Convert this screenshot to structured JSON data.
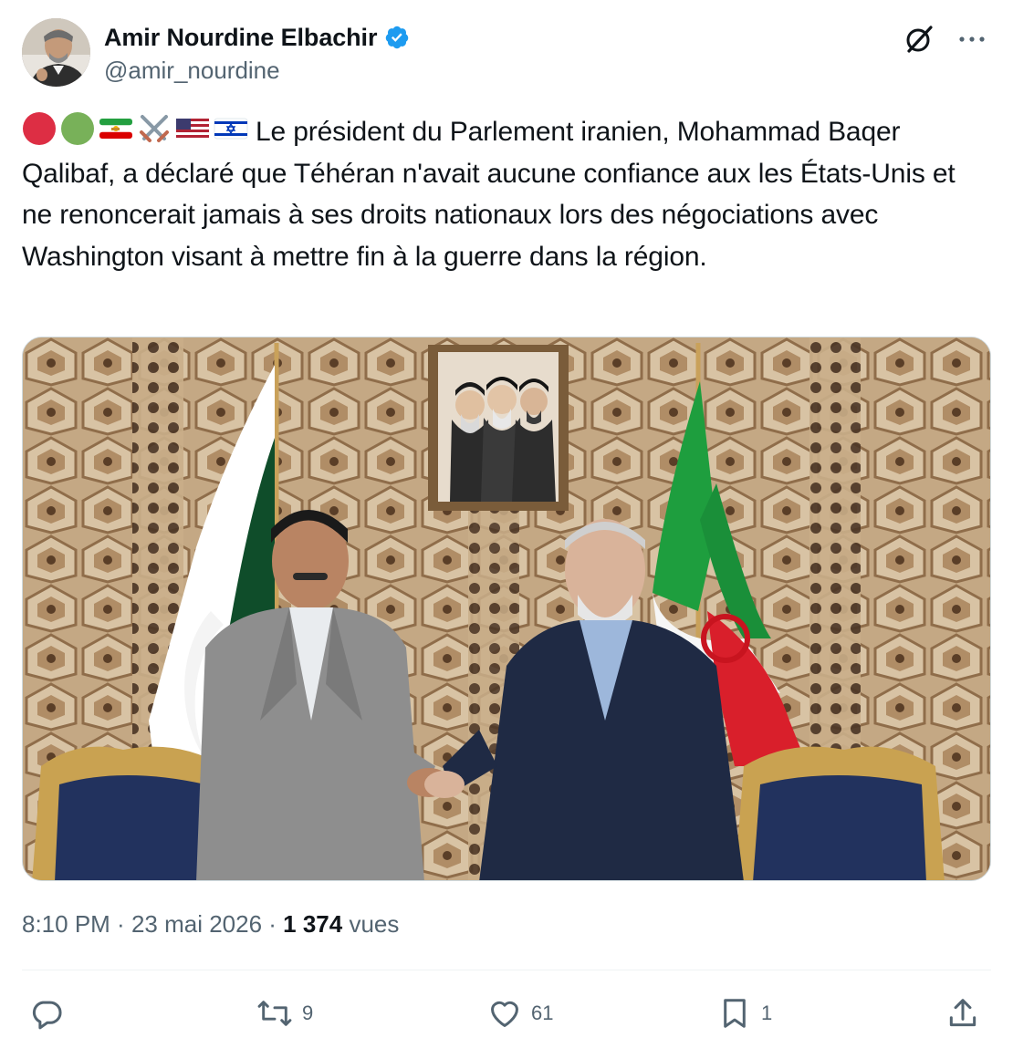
{
  "author": {
    "display_name": "Amir Nourdine Elbachir",
    "handle": "@amir_nourdine",
    "verified": true,
    "verified_color": "#1d9bf0"
  },
  "header_icons": [
    "grok-icon",
    "more-options-icon"
  ],
  "tweet": {
    "emojis": [
      "red-circle",
      "green-circle",
      "iran-lion-sun-flag",
      "crossed-swords",
      "us-flag",
      "israel-flag"
    ],
    "text": "Le président du Parlement iranien, Mohammad Baqer Qalibaf, a déclaré que Téhéran n'avait aucune confiance aux les États-Unis et ne renoncerait jamais à ses droits nationaux lors des négociations avec Washington visant à mettre fin à la guerre dans la région."
  },
  "media": {
    "type": "photo",
    "subjects": [
      "pakistan-flag",
      "iran-flag",
      "framed-portrait",
      "two-men-handshake"
    ]
  },
  "meta": {
    "time": "8:10 PM",
    "separator": " · ",
    "date": "23 mai 2026",
    "views_count": "1 374",
    "views_label": "vues"
  },
  "actions": {
    "reply": {
      "icon": "reply-icon",
      "count": ""
    },
    "repost": {
      "icon": "repost-icon",
      "count": "9"
    },
    "like": {
      "icon": "heart-icon",
      "count": "61"
    },
    "bookmark": {
      "icon": "bookmark-icon",
      "count": "1"
    },
    "share": {
      "icon": "share-icon",
      "count": ""
    }
  },
  "colors": {
    "text": "#0f1419",
    "secondary": "#536471",
    "divider": "#eff3f4",
    "accent": "#1d9bf0"
  }
}
